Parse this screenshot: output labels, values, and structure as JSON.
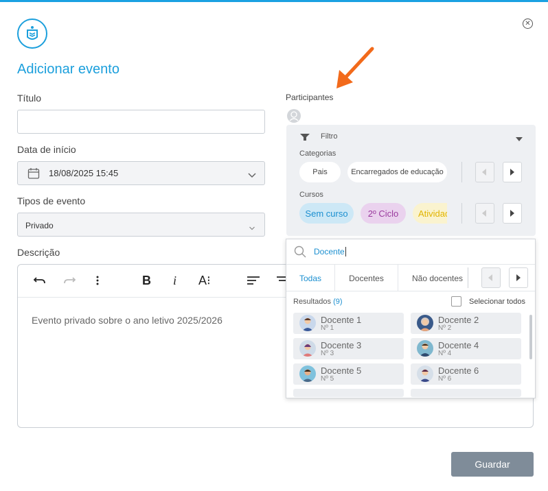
{
  "modal": {
    "title": "Adicionar evento",
    "close_icon": "close-circle-icon",
    "logo_icon": "school-logo-icon"
  },
  "form": {
    "titulo_label": "Título",
    "titulo_value": "",
    "data_inicio_label": "Data de início",
    "data_inicio_value": "18/08/2025 15:45",
    "tipos_evento_label": "Tipos de evento",
    "tipos_evento_value": "Privado",
    "descricao_label": "Descrição",
    "descricao_text": "Evento privado sobre o ano letivo 2025/2026"
  },
  "participants": {
    "label": "Participantes",
    "filter": {
      "label": "Filtro",
      "categorias_label": "Categorias",
      "categorias": [
        "Pais",
        "Encarregados de educação"
      ],
      "cursos_label": "Cursos",
      "cursos": [
        {
          "label": "Sem curso",
          "bg": "#cde8f6",
          "color": "#1b8fd0"
        },
        {
          "label": "2º Ciclo",
          "bg": "#ead2ee",
          "color": "#9a3a9e"
        },
        {
          "label": "Atividades",
          "bg": "#faf3cf",
          "color": "#e1b400"
        }
      ]
    },
    "search": {
      "value": "Docente",
      "tabs": [
        "Todas",
        "Docentes",
        "Não docentes"
      ],
      "active_tab": "Todas",
      "results_label": "Resultados",
      "results_count": "(9)",
      "select_all_label": "Selecionar todos",
      "results": [
        {
          "name": "Docente 1",
          "number": "Nº 1"
        },
        {
          "name": "Docente 2",
          "number": "Nº 2"
        },
        {
          "name": "Docente 3",
          "number": "Nº 3"
        },
        {
          "name": "Docente 4",
          "number": "Nº 4"
        },
        {
          "name": "Docente 5",
          "number": "Nº 5"
        },
        {
          "name": "Docente 6",
          "number": "Nº 6"
        }
      ]
    }
  },
  "actions": {
    "save_label": "Guardar"
  },
  "colors": {
    "accent": "#1b9fdc",
    "annotation_arrow": "#f26a1b",
    "save_button": "#7f8c99"
  }
}
